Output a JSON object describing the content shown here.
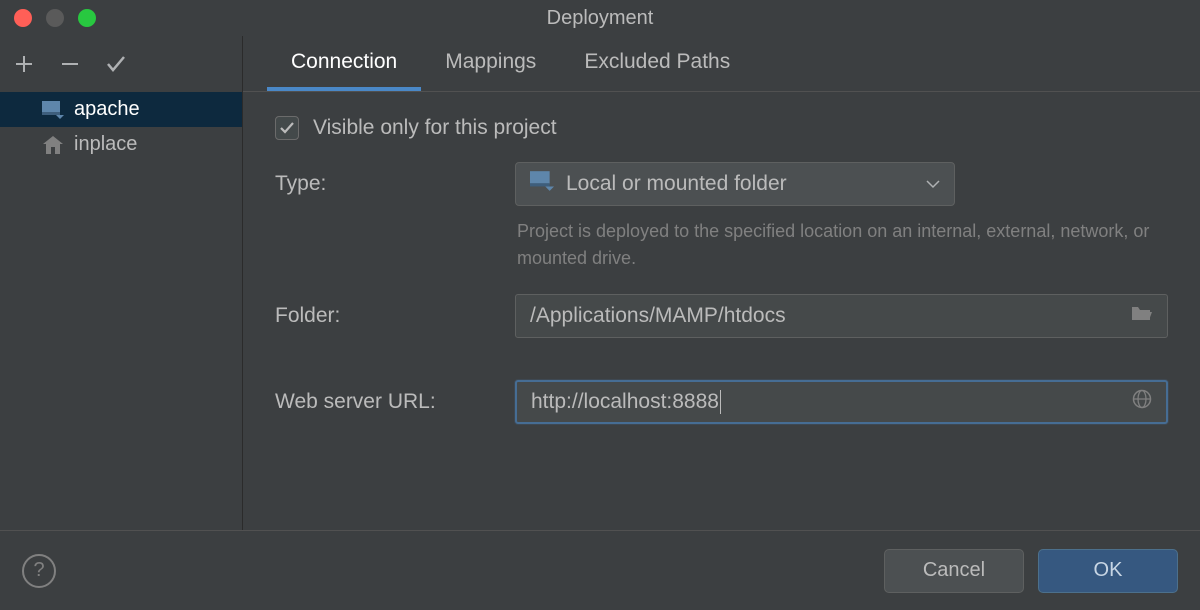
{
  "title": "Deployment",
  "sidebar": {
    "items": [
      {
        "label": "apache",
        "icon": "server-web-icon",
        "active": true
      },
      {
        "label": "inplace",
        "icon": "home-icon",
        "active": false
      }
    ]
  },
  "tabs": [
    {
      "label": "Connection",
      "active": true
    },
    {
      "label": "Mappings",
      "active": false
    },
    {
      "label": "Excluded Paths",
      "active": false
    }
  ],
  "form": {
    "visible_only_checked": true,
    "visible_only_label": "Visible only for this project",
    "type_label": "Type:",
    "type_value": "Local or mounted folder",
    "type_helper": "Project is deployed to the specified location on an internal, external, network, or mounted drive.",
    "folder_label": "Folder:",
    "folder_value": "/Applications/MAMP/htdocs",
    "url_label": "Web server URL:",
    "url_value": "http://localhost:8888"
  },
  "footer": {
    "help": "?",
    "cancel": "Cancel",
    "ok": "OK"
  }
}
